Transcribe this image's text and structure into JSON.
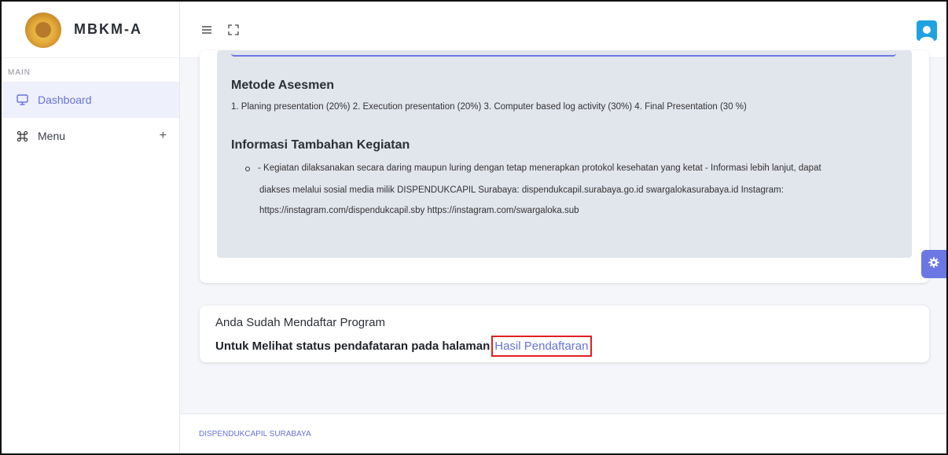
{
  "app": {
    "brand": "MBKM-A"
  },
  "sidebar": {
    "section_label": "MAIN",
    "items": [
      {
        "label": "Dashboard",
        "icon": "monitor-icon",
        "active": true
      },
      {
        "label": "Menu",
        "icon": "command-icon",
        "expand": "+"
      }
    ]
  },
  "topbar": {
    "menu_icon": "hamburger-icon",
    "fullscreen_icon": "fullscreen-icon",
    "avatar_icon": "user-avatar-icon"
  },
  "detail": {
    "metode_title": "Metode Asesmen",
    "metode_text": "1. Planing presentation (20%) 2. Execution presentation (20%) 3. Computer based log activity (30%) 4. Final Presentation (30 %)",
    "info_title": "Informasi Tambahan Kegiatan",
    "info_line1": "- Kegiatan dilaksanakan secara daring maupun luring dengan tetap menerapkan protokol kesehatan yang ketat - Informasi lebih lanjut, dapat",
    "info_line2": "diakses melalui sosial media milik DISPENDUKCAPIL Surabaya: dispendukcapil.surabaya.go.id swargalokasurabaya.id Instagram:",
    "info_line3": "https://instagram.com/dispendukcapil.sby https://instagram.com/swargaloka.sub"
  },
  "registration": {
    "line1": "Anda Sudah Mendaftar Program",
    "line2": "Untuk Melihat status pendafataran pada halaman",
    "link": "Hasil Pendaftaran"
  },
  "footer": {
    "text": "DISPENDUKCAPIL SURABAYA"
  },
  "colors": {
    "accent": "#6673d8",
    "highlight": "#e02020",
    "avatar": "#1fa2e0"
  }
}
